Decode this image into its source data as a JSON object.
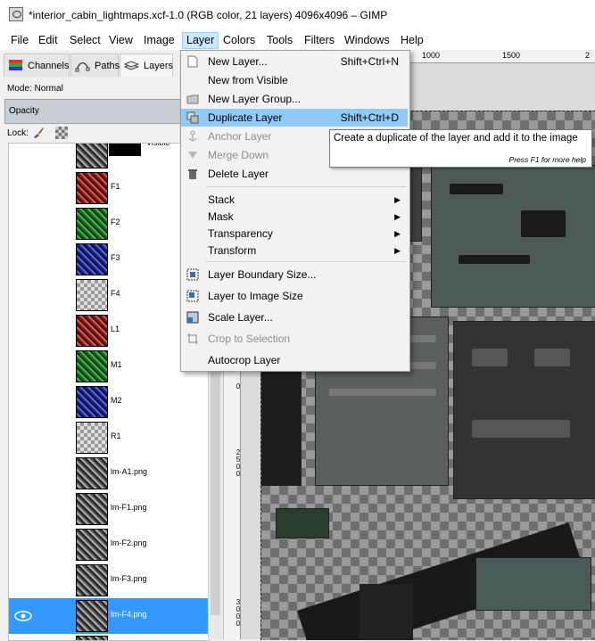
{
  "window": {
    "title": "*interior_cabin_lightmaps.xcf-1.0 (RGB color, 21 layers) 4096x4096 – GIMP"
  },
  "menubar": {
    "items": [
      "File",
      "Edit",
      "Select",
      "View",
      "Image",
      "Layer",
      "Colors",
      "Tools",
      "Filters",
      "Windows",
      "Help"
    ],
    "active": "Layer"
  },
  "dock": {
    "tabs": [
      "Channels",
      "Paths",
      "Layers"
    ],
    "mode_label": "Mode: Normal",
    "opacity_label": "Opacity",
    "lock_label": "Lock:"
  },
  "layers": [
    {
      "name": "Visible",
      "thumb": "tex",
      "visible": false,
      "mask": true
    },
    {
      "name": "F1",
      "thumb": "red",
      "visible": false
    },
    {
      "name": "F2",
      "thumb": "green",
      "visible": false
    },
    {
      "name": "F3",
      "thumb": "blue",
      "visible": false
    },
    {
      "name": "F4",
      "thumb": "checker",
      "visible": false
    },
    {
      "name": "L1",
      "thumb": "red",
      "visible": false
    },
    {
      "name": "M1",
      "thumb": "green",
      "visible": false
    },
    {
      "name": "M2",
      "thumb": "blue",
      "visible": false
    },
    {
      "name": "R1",
      "thumb": "checker",
      "visible": false
    },
    {
      "name": "lm-A1.png",
      "thumb": "tex",
      "visible": false
    },
    {
      "name": "lm-F1.png",
      "thumb": "tex",
      "visible": false
    },
    {
      "name": "lm-F2.png",
      "thumb": "tex",
      "visible": false
    },
    {
      "name": "lm-F3.png",
      "thumb": "tex",
      "visible": false
    },
    {
      "name": "lm-F4.png",
      "thumb": "tex",
      "visible": true,
      "selected": true
    },
    {
      "name": "",
      "thumb": "tex",
      "visible": false
    }
  ],
  "ruler": {
    "h_labels": [
      "1000",
      "1500",
      "2"
    ],
    "v_labels": [
      "0",
      "2500",
      "3000"
    ]
  },
  "layer_menu": {
    "items": [
      {
        "label": "New Layer...",
        "shortcut": "Shift+Ctrl+N",
        "icon": "new-layer-icon"
      },
      {
        "label": "New from Visible",
        "shortcut": "",
        "icon": ""
      },
      {
        "label": "New Layer Group...",
        "shortcut": "",
        "icon": "folder-icon"
      },
      {
        "label": "Duplicate Layer",
        "shortcut": "Shift+Ctrl+D",
        "icon": "duplicate-icon",
        "highlight": true
      },
      {
        "label": "Anchor Layer",
        "shortcut": "",
        "icon": "anchor-icon",
        "disabled": true
      },
      {
        "label": "Merge Down",
        "shortcut": "",
        "icon": "merge-icon",
        "disabled": true
      },
      {
        "label": "Delete Layer",
        "shortcut": "",
        "icon": "delete-icon"
      },
      {
        "sep": true
      },
      {
        "label": "Stack",
        "submenu": true
      },
      {
        "label": "Mask",
        "submenu": true
      },
      {
        "label": "Transparency",
        "submenu": true
      },
      {
        "label": "Transform",
        "submenu": true
      },
      {
        "sep": true
      },
      {
        "label": "Layer Boundary Size...",
        "icon": "boundary-icon"
      },
      {
        "label": "Layer to Image Size",
        "icon": "to-image-icon"
      },
      {
        "label": "Scale Layer...",
        "icon": "scale-icon"
      },
      {
        "label": "Crop to Selection",
        "icon": "crop-icon",
        "disabled": true
      },
      {
        "label": "Autocrop Layer",
        "icon": ""
      }
    ]
  },
  "tooltip": {
    "text": "Create a duplicate of the layer and add it to the image",
    "hint": "Press F1 for more help"
  }
}
